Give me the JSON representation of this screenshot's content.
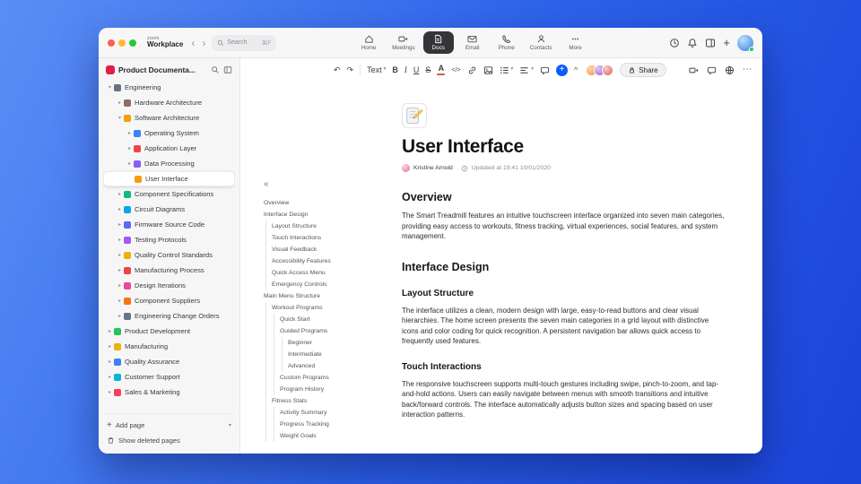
{
  "titlebar": {
    "logo_top": "zoom",
    "logo_bottom": "Workplace",
    "back_arrow": "‹",
    "forward_arrow": "›",
    "search_placeholder": "Search",
    "search_shortcut": "⌘F",
    "tabs": [
      {
        "label": "Home",
        "icon": "home",
        "active": false
      },
      {
        "label": "Meetings",
        "icon": "meetings",
        "active": false
      },
      {
        "label": "Docs",
        "icon": "docs",
        "active": true
      },
      {
        "label": "Email",
        "icon": "email",
        "active": false
      },
      {
        "label": "Phone",
        "icon": "phone",
        "active": false
      },
      {
        "label": "Contacts",
        "icon": "contacts",
        "active": false
      },
      {
        "label": "More",
        "icon": "more",
        "active": false
      }
    ]
  },
  "sidebar": {
    "title": "Product Documenta...",
    "tree": [
      {
        "label": "Engineering",
        "level": 0,
        "chevron": "down",
        "color": "#6b7280"
      },
      {
        "label": "Hardware Architecture",
        "level": 1,
        "chevron": "right",
        "color": "#8d6e63"
      },
      {
        "label": "Software Architecture",
        "level": 1,
        "chevron": "down",
        "color": "#f59e0b"
      },
      {
        "label": "Operating System",
        "level": 2,
        "chevron": "right",
        "color": "#3b82f6"
      },
      {
        "label": "Application Layer",
        "level": 2,
        "chevron": "right",
        "color": "#ef4444"
      },
      {
        "label": "Data Processing",
        "level": 2,
        "chevron": "right",
        "color": "#8b5cf6"
      },
      {
        "label": "User Interface",
        "level": 2,
        "chevron": "none",
        "color": "#f59e0b",
        "selected": true
      },
      {
        "label": "Component Specifications",
        "level": 1,
        "chevron": "right",
        "color": "#10b981"
      },
      {
        "label": "Circuit Diagrams",
        "level": 1,
        "chevron": "right",
        "color": "#0ea5e9"
      },
      {
        "label": "Firmware Source Code",
        "level": 1,
        "chevron": "right",
        "color": "#6366f1"
      },
      {
        "label": "Testing Protocols",
        "level": 1,
        "chevron": "right",
        "color": "#a855f7"
      },
      {
        "label": "Quality Control Standards",
        "level": 1,
        "chevron": "right",
        "color": "#eab308"
      },
      {
        "label": "Manufacturing Process",
        "level": 1,
        "chevron": "right",
        "color": "#ef4444"
      },
      {
        "label": "Design Iterations",
        "level": 1,
        "chevron": "right",
        "color": "#ec4899"
      },
      {
        "label": "Component Suppliers",
        "level": 1,
        "chevron": "right",
        "color": "#f97316"
      },
      {
        "label": "Engineering Change Orders",
        "level": 1,
        "chevron": "right",
        "color": "#64748b"
      },
      {
        "label": "Product Development",
        "level": 0,
        "chevron": "right",
        "color": "#22c55e"
      },
      {
        "label": "Manufacturing",
        "level": 0,
        "chevron": "right",
        "color": "#eab308"
      },
      {
        "label": "Quality Assurance",
        "level": 0,
        "chevron": "right",
        "color": "#3b82f6"
      },
      {
        "label": "Customer Support",
        "level": 0,
        "chevron": "right",
        "color": "#06b6d4"
      },
      {
        "label": "Sales & Marketing",
        "level": 0,
        "chevron": "right",
        "color": "#f43f5e"
      }
    ],
    "add_page": "Add page",
    "show_deleted": "Show deleted pages"
  },
  "toolbar": {
    "undo": "↶",
    "redo": "↷",
    "text_style": "Text",
    "bold": "B",
    "italic": "I",
    "underline": "U",
    "strikethrough": "S",
    "text_color": "A",
    "inline_code": "</>",
    "share": "Share",
    "accent_color": "#0b5cff"
  },
  "outline": [
    {
      "label": "Overview",
      "level": 0
    },
    {
      "label": "Interface Design",
      "level": 0
    },
    {
      "label": "Layout Structure",
      "level": 1
    },
    {
      "label": "Touch Interactions",
      "level": 1
    },
    {
      "label": "Visual Feedback",
      "level": 1
    },
    {
      "label": "Accessibility Features",
      "level": 1
    },
    {
      "label": "Quick Access Menu",
      "level": 1
    },
    {
      "label": "Emergency Controls",
      "level": 1
    },
    {
      "label": "Main Menu Structure",
      "level": 0
    },
    {
      "label": "Workout Programs",
      "level": 1
    },
    {
      "label": "Quick Start",
      "level": 2
    },
    {
      "label": "Guided Programs",
      "level": 2
    },
    {
      "label": "Beginner",
      "level": 3
    },
    {
      "label": "Intermediate",
      "level": 3
    },
    {
      "label": "Advanced",
      "level": 3
    },
    {
      "label": "Custom Programs",
      "level": 2
    },
    {
      "label": "Program History",
      "level": 2
    },
    {
      "label": "Fitness Stats",
      "level": 1
    },
    {
      "label": "Activity Summary",
      "level": 2
    },
    {
      "label": "Progress Tracking",
      "level": 2
    },
    {
      "label": "Weight Goals",
      "level": 2
    }
  ],
  "doc": {
    "title": "User Interface",
    "author": "Kristine Arnold",
    "updated": "Updated at 19:41 10/01/2020",
    "sections": [
      {
        "type": "h2",
        "text": "Overview"
      },
      {
        "type": "p",
        "text": "The Smart Treadmill features an intuitive touchscreen interface organized into seven main categories, providing easy access to workouts, fitness tracking, virtual experiences, social features, and system management."
      },
      {
        "type": "h2",
        "text": "Interface Design"
      },
      {
        "type": "h3",
        "text": "Layout Structure"
      },
      {
        "type": "p",
        "text": "The interface utilizes a clean, modern design with large, easy-to-read buttons and clear visual hierarchies. The home screen presents the seven main categories in a grid layout with distinctive icons and color coding for quick recognition. A persistent navigation bar allows quick access to frequently used features."
      },
      {
        "type": "h3",
        "text": "Touch Interactions"
      },
      {
        "type": "p",
        "text": "The responsive touchscreen supports multi-touch gestures including swipe, pinch-to-zoom, and tap-and-hold actions. Users can easily navigate between menus with smooth transitions and intuitive back/forward controls. The interface automatically adjusts button sizes and spacing based on user interaction patterns."
      }
    ]
  }
}
